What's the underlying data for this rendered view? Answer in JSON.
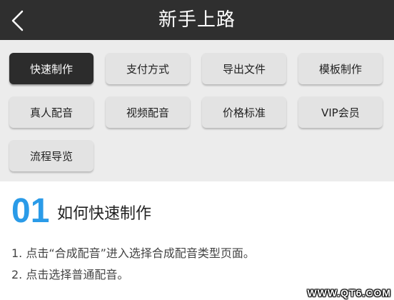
{
  "header": {
    "title": "新手上路",
    "back_icon": "chevron-left-icon"
  },
  "menu": {
    "items": [
      {
        "label": "快速制作",
        "active": true
      },
      {
        "label": "支付方式",
        "active": false
      },
      {
        "label": "导出文件",
        "active": false
      },
      {
        "label": "模板制作",
        "active": false
      },
      {
        "label": "真人配音",
        "active": false
      },
      {
        "label": "视频配音",
        "active": false
      },
      {
        "label": "价格标准",
        "active": false
      },
      {
        "label": "VIP会员",
        "active": false
      },
      {
        "label": "流程导览",
        "active": false
      }
    ]
  },
  "section": {
    "number": "01",
    "title": "如何快速制作",
    "steps": [
      "1. 点击“合成配音”进入选择合成配音类型页面。",
      "2. 点击选择普通配音。"
    ]
  },
  "watermark": "WWW.QT6.COM",
  "colors": {
    "header_bg": "#2f2f2f",
    "active_button_bg": "#2c2c2c",
    "button_bg": "#e3e3e3",
    "accent": "#2a9be8"
  }
}
